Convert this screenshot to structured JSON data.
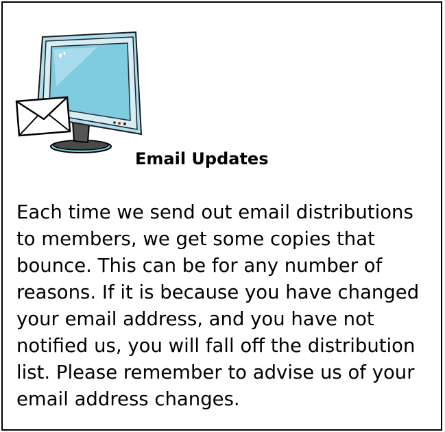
{
  "card": {
    "illustration_icon": "computer-monitor-email-icon",
    "title": "Email Updates",
    "body": "Each time we send out email distributions to members, we get some copies that bounce. This can be for any number of reasons. If it is because you have changed your email address, and you have not notified us, you will fall off the distribution list. Please remember to advise us of your email address changes."
  },
  "colors": {
    "border": "#000000",
    "screen": "#7fcbe0",
    "monitor_frame": "#aedff0",
    "stand": "#4a4a4a",
    "text": "#000000"
  }
}
